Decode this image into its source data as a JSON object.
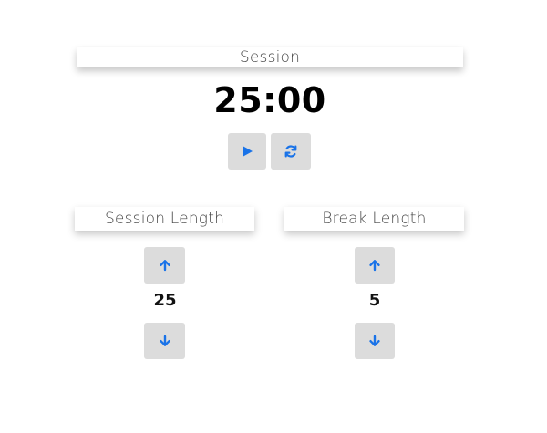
{
  "session_panel": {
    "label": "Session",
    "timer": "25:00"
  },
  "session_length": {
    "label": "Session Length",
    "value": "25"
  },
  "break_length": {
    "label": "Break Length",
    "value": "5"
  },
  "icons": {
    "play": "play-icon",
    "reset": "refresh-icon",
    "increment": "arrow-up-icon",
    "decrement": "arrow-down-icon"
  },
  "colors": {
    "accent": "#1a73e8",
    "button_bg": "#dcdcdc"
  }
}
